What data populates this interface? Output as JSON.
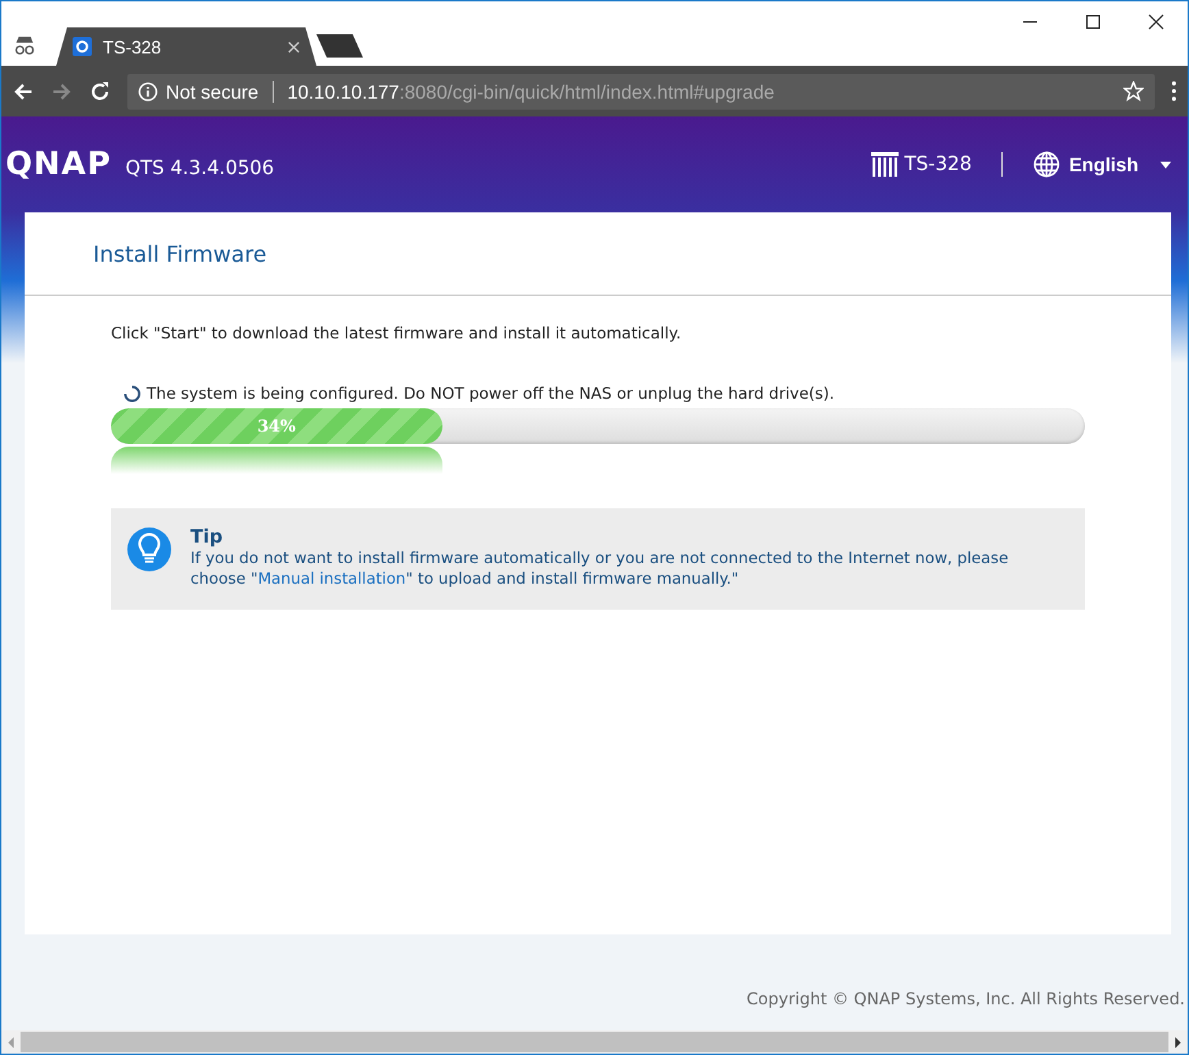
{
  "browser": {
    "tab_title": "TS-328",
    "security": "Not secure",
    "url_host": "10.10.10.177",
    "url_rest": ":8080/cgi-bin/quick/html/index.html#upgrade"
  },
  "header": {
    "logo": "QNAP",
    "version": "QTS 4.3.4.0506",
    "device": "TS-328",
    "language": "English"
  },
  "page": {
    "title": "Install Firmware",
    "intro": "Click \"Start\" to download the latest firmware and install it automatically.",
    "status": "The system is being configured. Do NOT power off the NAS or unplug the hard drive(s).",
    "progress": {
      "level": 0.34,
      "reading": "34%"
    }
  },
  "tip": {
    "title": "Tip",
    "text_before": "If you do not want to install firmware automatically or you are not connected to the Internet now, please choose \"",
    "link": "Manual installation",
    "text_after": "\" to upload and install firmware manually.\""
  },
  "footer": {
    "copyright": "Copyright © QNAP Systems, Inc. All Rights Reserved."
  }
}
